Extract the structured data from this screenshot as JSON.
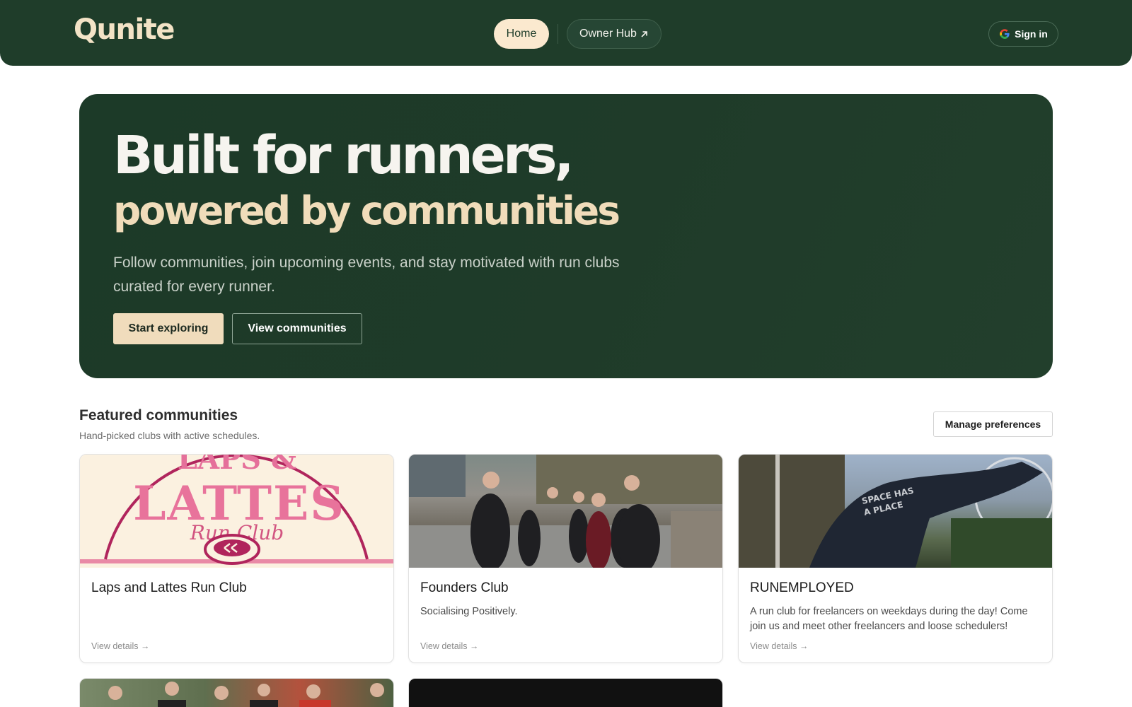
{
  "app": {
    "logo": "Qunite"
  },
  "nav": {
    "home_label": "Home",
    "owner_hub_label": "Owner Hub",
    "owner_hub_icon": "external-arrow-icon",
    "sign_in_label": "Sign in",
    "sign_in_icon": "google-icon"
  },
  "hero": {
    "line1": "Built for runners,",
    "line2": "powered by communities",
    "subtitle": "Follow communities, join upcoming events, and stay motivated with run clubs curated for every runner.",
    "primary_cta": "Start exploring",
    "secondary_cta": "View communities"
  },
  "featured": {
    "title": "Featured communities",
    "subtitle": "Hand-picked clubs with active schedules.",
    "manage_label": "Manage preferences",
    "cards": [
      {
        "name": "Laps and Lattes Run Club",
        "description": "",
        "link": "View details →",
        "image_text": "LAPS & LATTES",
        "image_script": "Run Club"
      },
      {
        "name": "Founders Club",
        "description": "Socialising Positively.",
        "link": "View details →"
      },
      {
        "name": "RUNEMPLOYED",
        "description": "A run club for freelancers on weekdays during the day! Come join us and meet other freelancers and loose schedulers!",
        "link": "View details →",
        "image_text": "SPACE HAS A PLACE"
      }
    ]
  },
  "colors": {
    "brand_green": "#1f3d2a",
    "brand_cream": "#f0dcbc"
  }
}
